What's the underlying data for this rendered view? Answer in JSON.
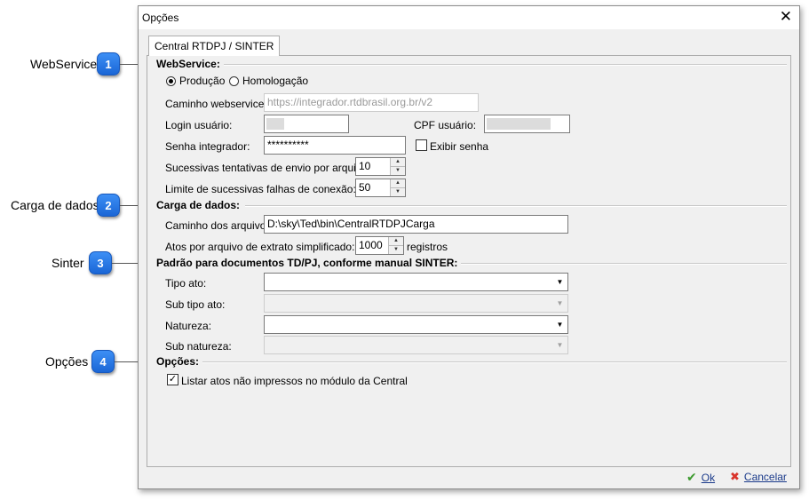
{
  "callouts": [
    {
      "number": "1",
      "label": "WebService"
    },
    {
      "number": "2",
      "label": "Carga de dados"
    },
    {
      "number": "3",
      "label": "Sinter"
    },
    {
      "number": "4",
      "label": "Opções"
    }
  ],
  "window": {
    "title": "Opções",
    "tab_label": "Central RTDPJ / SINTER"
  },
  "webservice": {
    "section_title": "WebService:",
    "radio_producao": "Produção",
    "radio_homologacao": "Homologação",
    "selected": "Produção",
    "caminho_label": "Caminho webservice:",
    "caminho_value": "https://integrador.rtdbrasil.org.br/v2",
    "login_label": "Login usuário:",
    "cpf_label": "CPF usuário:",
    "senha_label": "Senha integrador:",
    "senha_value": "**********",
    "exibir_senha_label": "Exibir senha",
    "exibir_senha_checked": false,
    "tentativas_label": "Sucessivas tentativas de envio por arquivo:",
    "tentativas_value": "10",
    "falhas_label": "Limite de sucessivas falhas de conexão:",
    "falhas_value": "50"
  },
  "carga": {
    "section_title": "Carga de dados:",
    "caminho_label": "Caminho dos arquivos:",
    "caminho_value": "D:\\sky\\Ted\\bin\\CentralRTDPJCarga",
    "atos_label": "Atos por arquivo de extrato simplificado:",
    "atos_value": "1000",
    "atos_unit": "registros"
  },
  "sinter": {
    "section_title": "Padrão para documentos TD/PJ, conforme manual SINTER:",
    "tipo_ato_label": "Tipo ato:",
    "sub_tipo_ato_label": "Sub tipo ato:",
    "natureza_label": "Natureza:",
    "sub_natureza_label": "Sub natureza:"
  },
  "opcoes": {
    "section_title": "Opções:",
    "listar_label": "Listar atos não impressos no módulo da Central",
    "listar_checked": true
  },
  "footer": {
    "ok_label": "Ok",
    "cancel_label": "Cancelar"
  },
  "colors": {
    "callout_blue": "#1a66d6",
    "ok_green": "#3c9a2e",
    "cancel_red": "#d9342b"
  }
}
